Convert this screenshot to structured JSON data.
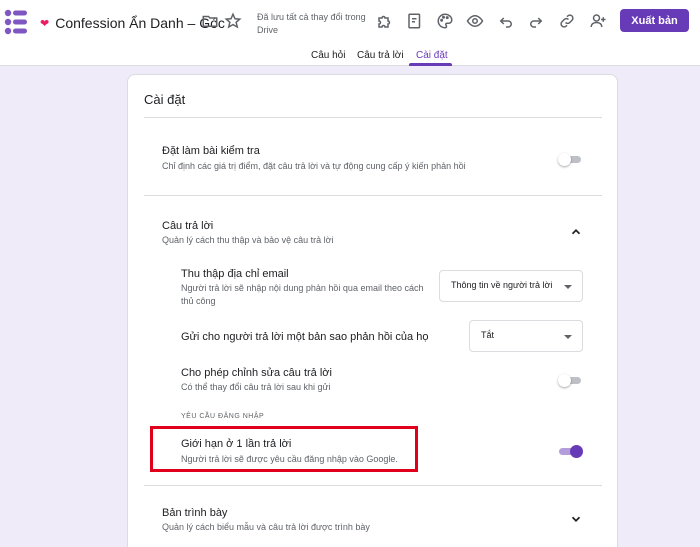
{
  "topbar": {
    "doc_title": "Confession Ẩn Danh – Góc",
    "heart_icon": "❤",
    "saved_status": "Đã lưu tất cả thay đổi trong Drive",
    "publish_label": "Xuất bản",
    "accent_color": "#673ab7"
  },
  "tabs": [
    {
      "label": "Câu hỏi"
    },
    {
      "label": "Câu trả lời"
    },
    {
      "label": "Cài đặt"
    }
  ],
  "settings": {
    "title": "Cài đặt",
    "quiz": {
      "title": "Đặt làm bài kiểm tra",
      "subtitle": "Chỉ định các giá trị điểm, đặt câu trả lời và tự động cung cấp ý kiến phản hồi",
      "toggle_on": false
    },
    "responses": {
      "title": "Câu trả lời",
      "subtitle": "Quản lý cách thu thập và bảo vệ câu trả lời",
      "collect_email": {
        "title": "Thu thập địa chỉ email",
        "subtitle": "Người trả lời sẽ nhập nội dung phản hồi qua email theo cách thủ công",
        "selected": "Thông tin về người trả lời"
      },
      "send_copy": {
        "title": "Gửi cho người trả lời một bản sao phản hồi của họ",
        "selected": "Tắt"
      },
      "allow_edit": {
        "title": "Cho phép chỉnh sửa câu trả lời",
        "subtitle": "Có thể thay đổi câu trả lời sau khi gửi",
        "toggle_on": false
      },
      "login_required_heading": "YÊU CẦU ĐĂNG NHẬP",
      "limit_one": {
        "title": "Giới hạn ở 1 lần trả lời",
        "subtitle": "Người trả lời sẽ được yêu cầu đăng nhập vào Google.",
        "toggle_on": true
      }
    },
    "presentation": {
      "title": "Bản trình bày",
      "subtitle": "Quản lý cách biểu mẫu và câu trả lời được trình bày"
    }
  }
}
